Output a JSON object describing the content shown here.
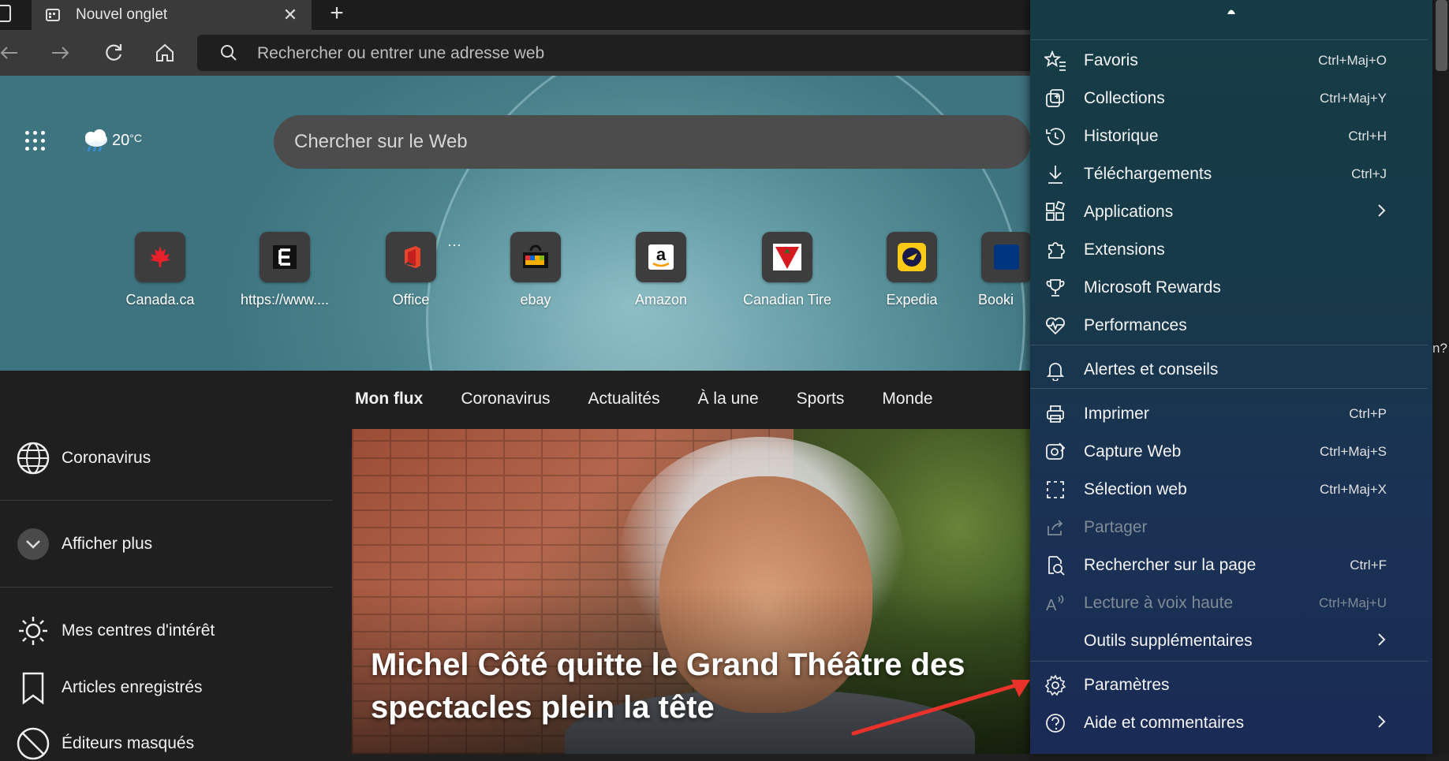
{
  "tab": {
    "title": "Nouvel onglet",
    "close": "✕",
    "new_tab": "+"
  },
  "address": {
    "placeholder": "Rechercher ou entrer une adresse web"
  },
  "weather": {
    "temperature": "20",
    "unit": "°C"
  },
  "search": {
    "placeholder": "Chercher sur le Web"
  },
  "quick_links": [
    {
      "label": "Canada.ca",
      "icon": "canada-maple-leaf-icon"
    },
    {
      "label": "https://www....",
      "icon": "e-logo-icon"
    },
    {
      "label": "Office",
      "icon": "office-logo-icon"
    },
    {
      "label": "ebay",
      "icon": "ebay-bag-icon"
    },
    {
      "label": "Amazon",
      "icon": "amazon-logo-icon"
    },
    {
      "label": "Canadian Tire",
      "icon": "canadian-tire-logo-icon"
    },
    {
      "label": "Expedia",
      "icon": "expedia-logo-icon"
    },
    {
      "label": "Booki",
      "icon": "booking-logo-icon"
    }
  ],
  "quick_links_more": "···",
  "feed_tabs": [
    "Mon flux",
    "Coronavirus",
    "Actualités",
    "À la une",
    "Sports",
    "Monde"
  ],
  "sidebar": [
    {
      "label": "Coronavirus",
      "icon": "globe-icon"
    },
    {
      "label": "Afficher plus",
      "icon": "chevron-down-circle-icon"
    },
    {
      "label": "Mes centres d'intérêt",
      "icon": "sun-icon"
    },
    {
      "label": "Articles enregistrés",
      "icon": "bookmark-icon"
    },
    {
      "label": "Éditeurs masqués",
      "icon": "block-icon"
    }
  ],
  "article": {
    "headline": "Michel Côté quitte le Grand Théâtre des spectacles plein la tête"
  },
  "menu": {
    "items": [
      {
        "label": "Favoris",
        "shortcut": "Ctrl+Maj+O",
        "icon": "star-list-icon"
      },
      {
        "label": "Collections",
        "shortcut": "Ctrl+Maj+Y",
        "icon": "collections-icon"
      },
      {
        "label": "Historique",
        "shortcut": "Ctrl+H",
        "icon": "history-icon"
      },
      {
        "label": "Téléchargements",
        "shortcut": "Ctrl+J",
        "icon": "download-icon"
      },
      {
        "label": "Applications",
        "shortcut": "",
        "icon": "apps-icon",
        "chevron": true
      },
      {
        "label": "Extensions",
        "shortcut": "",
        "icon": "puzzle-icon"
      },
      {
        "label": "Microsoft Rewards",
        "shortcut": "",
        "icon": "trophy-icon"
      },
      {
        "label": "Performances",
        "shortcut": "",
        "icon": "heartbeat-icon"
      },
      {
        "label": "Alertes et conseils",
        "shortcut": "",
        "icon": "bell-icon"
      },
      {
        "label": "Imprimer",
        "shortcut": "Ctrl+P",
        "icon": "printer-icon"
      },
      {
        "label": "Capture Web",
        "shortcut": "Ctrl+Maj+S",
        "icon": "web-capture-icon"
      },
      {
        "label": "Sélection web",
        "shortcut": "Ctrl+Maj+X",
        "icon": "web-select-icon"
      },
      {
        "label": "Partager",
        "shortcut": "",
        "icon": "share-icon",
        "disabled": true
      },
      {
        "label": "Rechercher sur la page",
        "shortcut": "Ctrl+F",
        "icon": "find-in-page-icon"
      },
      {
        "label": "Lecture à voix haute",
        "shortcut": "Ctrl+Maj+U",
        "icon": "read-aloud-icon",
        "disabled": true
      },
      {
        "label": "Outils supplémentaires",
        "shortcut": "",
        "icon": "",
        "chevron": true
      },
      {
        "label": "Paramètres",
        "shortcut": "",
        "icon": "gear-icon"
      },
      {
        "label": "Aide et commentaires",
        "shortcut": "",
        "icon": "help-icon",
        "chevron": true
      }
    ]
  },
  "edge_peek_text": "n?",
  "colors": {
    "annotation_arrow": "#e8322a",
    "menu_bg": "#173a48"
  }
}
